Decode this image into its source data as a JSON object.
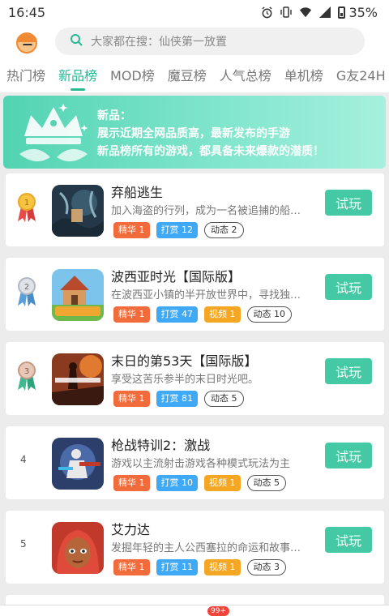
{
  "status_bar": {
    "time": "16:45",
    "battery": "35%"
  },
  "search": {
    "placeholder": "大家都在搜：仙侠第一放置"
  },
  "tabs": [
    {
      "label": "热门榜"
    },
    {
      "label": "新品榜"
    },
    {
      "label": "MOD榜"
    },
    {
      "label": "魔豆榜"
    },
    {
      "label": "人气总榜"
    },
    {
      "label": "单机榜"
    },
    {
      "label": "G友24H"
    }
  ],
  "banner": {
    "title": "新品：",
    "line1": "展示近期全网品质高，最新发布的手游",
    "line2": "新品榜所有的游戏，都具备未来爆款的潜质！"
  },
  "games": [
    {
      "rank": "1",
      "title": "弃船逃生",
      "desc": "加入海盗的行列，成为一名被追捕的船…",
      "tags": [
        "精华 1",
        "打赏 12",
        "动态 2"
      ],
      "button": "试玩"
    },
    {
      "rank": "2",
      "title": "波西亚时光【国际版】",
      "desc": "在波西亚小镇的半开放世界中，寻找独…",
      "tags": [
        "精华 1",
        "打赏 47",
        "视频 1",
        "动态 10"
      ],
      "button": "试玩"
    },
    {
      "rank": "3",
      "title": "末日的第53天【国际版】",
      "desc": "享受这苦乐参半的末日时光吧。",
      "tags": [
        "精华 1",
        "打赏 81",
        "动态 5"
      ],
      "button": "试玩"
    },
    {
      "rank": "4",
      "title": "枪战特训2：激战",
      "desc": "游戏以主流射击游戏各种模式玩法为主",
      "tags": [
        "精华 1",
        "打赏 10",
        "视频 1",
        "动态 5"
      ],
      "button": "试玩"
    },
    {
      "rank": "5",
      "title": "艾力达",
      "desc": "发掘年轻的主人公西塞拉的命运和故事…",
      "tags": [
        "精华 1",
        "打赏 11",
        "视频 1",
        "动态 3"
      ],
      "button": "试玩"
    }
  ],
  "bottom_nav": {
    "badge": "99+"
  },
  "colors": {
    "accent": "#29b993",
    "button": "#45c9a4",
    "tag_jinghua": "#f26b3a",
    "tag_dashang": "#3fa9f5",
    "tag_shipin": "#f5a623"
  }
}
